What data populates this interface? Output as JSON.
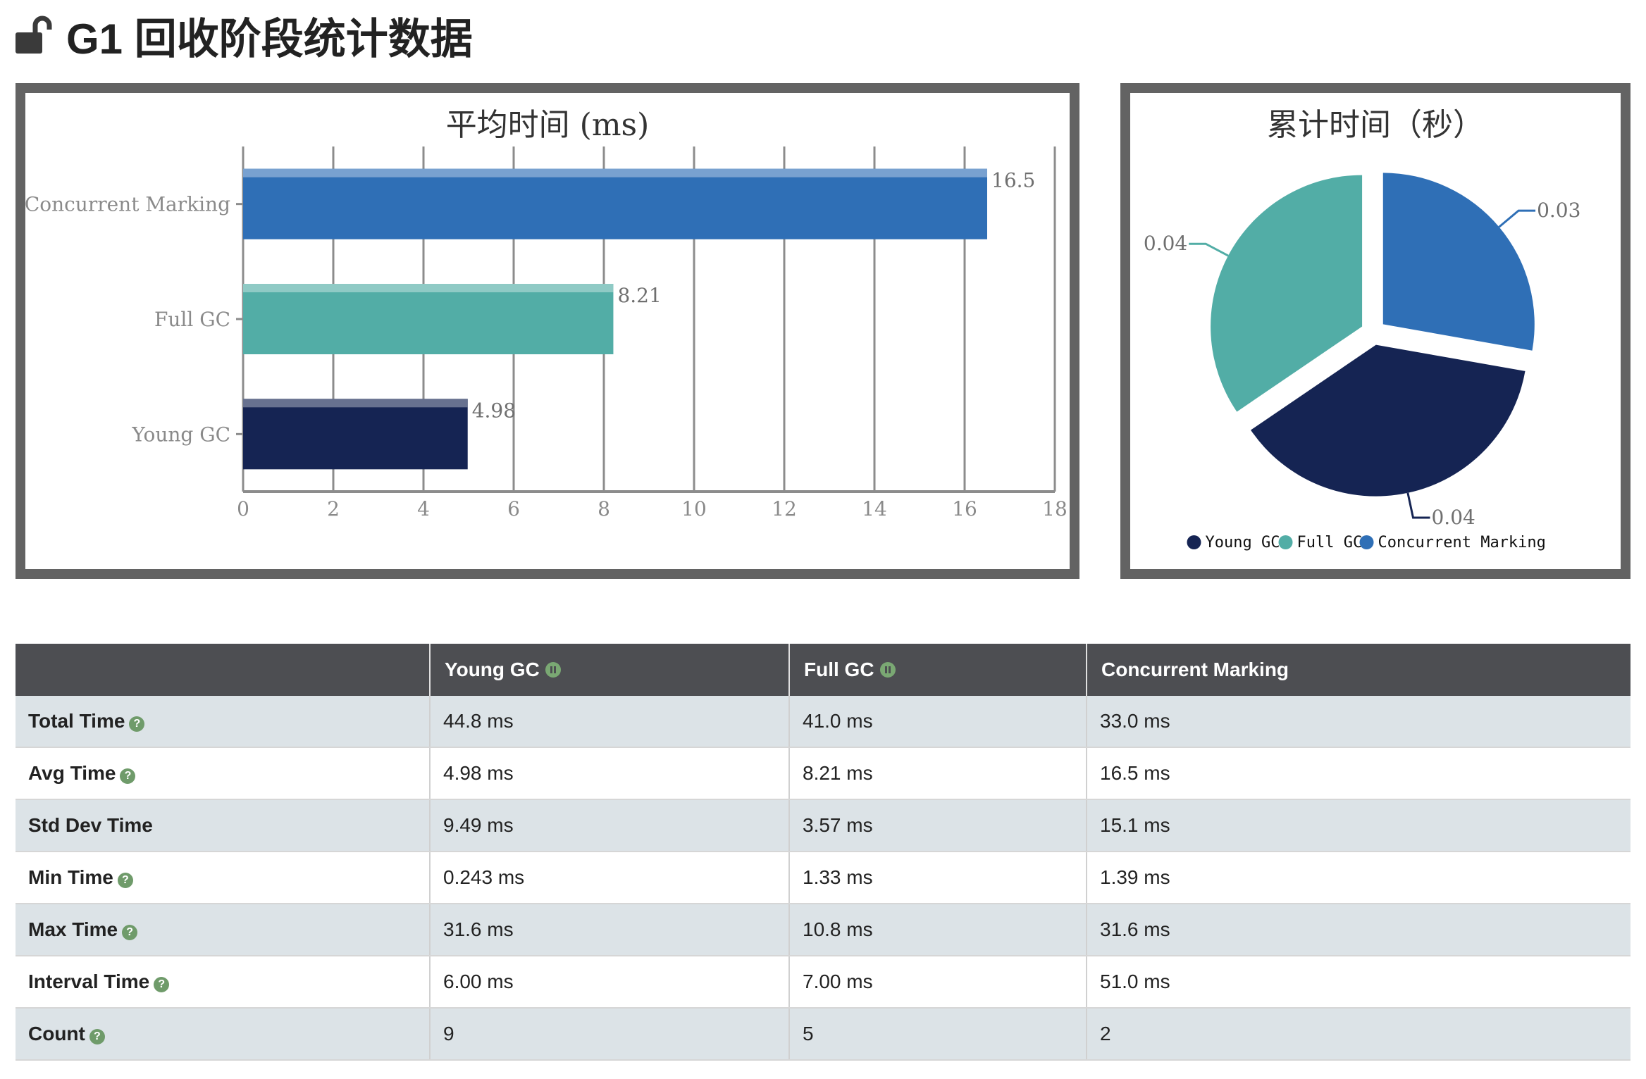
{
  "page": {
    "title": "G1 回收阶段统计数据",
    "lock_icon": "unlocked-padlock-icon"
  },
  "colors": {
    "young_gc": "#152453",
    "full_gc": "#52ada6",
    "concurrent_marking": "#2f6fb6",
    "panel_border": "#636363",
    "table_header": "#4d4e52",
    "row_stripe": "#dce3e7",
    "help_icon": "#6f9b6a"
  },
  "chart_data": [
    {
      "type": "bar",
      "orientation": "horizontal",
      "title": "平均时间 (ms)",
      "xlabel": "",
      "ylabel": "",
      "categories": [
        "Concurrent Marking",
        "Full GC",
        "Young GC"
      ],
      "values": [
        16.5,
        8.21,
        4.98
      ],
      "value_labels": [
        "16.5",
        "8.21",
        "4.98"
      ],
      "colors": [
        "#2f6fb6",
        "#52ada6",
        "#152453"
      ],
      "xlim": [
        0,
        18
      ],
      "x_ticks": [
        "0",
        "2",
        "4",
        "6",
        "8",
        "10",
        "12",
        "14",
        "16",
        "18"
      ],
      "grid": "vertical"
    },
    {
      "type": "pie",
      "title": "累计时间（秒）",
      "slices": [
        {
          "name": "Young GC",
          "value": 0.0448,
          "label": "0.04",
          "color": "#152453"
        },
        {
          "name": "Full GC",
          "value": 0.041,
          "label": "0.04",
          "color": "#52ada6"
        },
        {
          "name": "Concurrent Marking",
          "value": 0.033,
          "label": "0.03",
          "color": "#2f6fb6"
        }
      ],
      "legend": [
        "Young GC",
        "Full GC",
        "Concurrent Marking"
      ],
      "legend_position": "bottom"
    }
  ],
  "table": {
    "headers": [
      {
        "label": "",
        "icon": ""
      },
      {
        "label": "Young GC",
        "icon": "pause-icon"
      },
      {
        "label": "Full GC",
        "icon": "pause-icon"
      },
      {
        "label": "Concurrent Marking",
        "icon": ""
      }
    ],
    "help_glyph": "?",
    "rows": [
      {
        "label": "Total Time",
        "help": true,
        "values": [
          "44.8 ms",
          "41.0 ms",
          "33.0 ms"
        ]
      },
      {
        "label": "Avg Time",
        "help": true,
        "values": [
          "4.98 ms",
          "8.21 ms",
          "16.5 ms"
        ]
      },
      {
        "label": "Std Dev Time",
        "help": false,
        "values": [
          "9.49 ms",
          "3.57 ms",
          "15.1 ms"
        ]
      },
      {
        "label": "Min Time",
        "help": true,
        "values": [
          "0.243 ms",
          "1.33 ms",
          "1.39 ms"
        ]
      },
      {
        "label": "Max Time",
        "help": true,
        "values": [
          "31.6 ms",
          "10.8 ms",
          "31.6 ms"
        ]
      },
      {
        "label": "Interval Time",
        "help": true,
        "values": [
          "6.00 ms",
          "7.00 ms",
          "51.0 ms"
        ]
      },
      {
        "label": "Count",
        "help": true,
        "values": [
          "9",
          "5",
          "2"
        ]
      }
    ]
  }
}
